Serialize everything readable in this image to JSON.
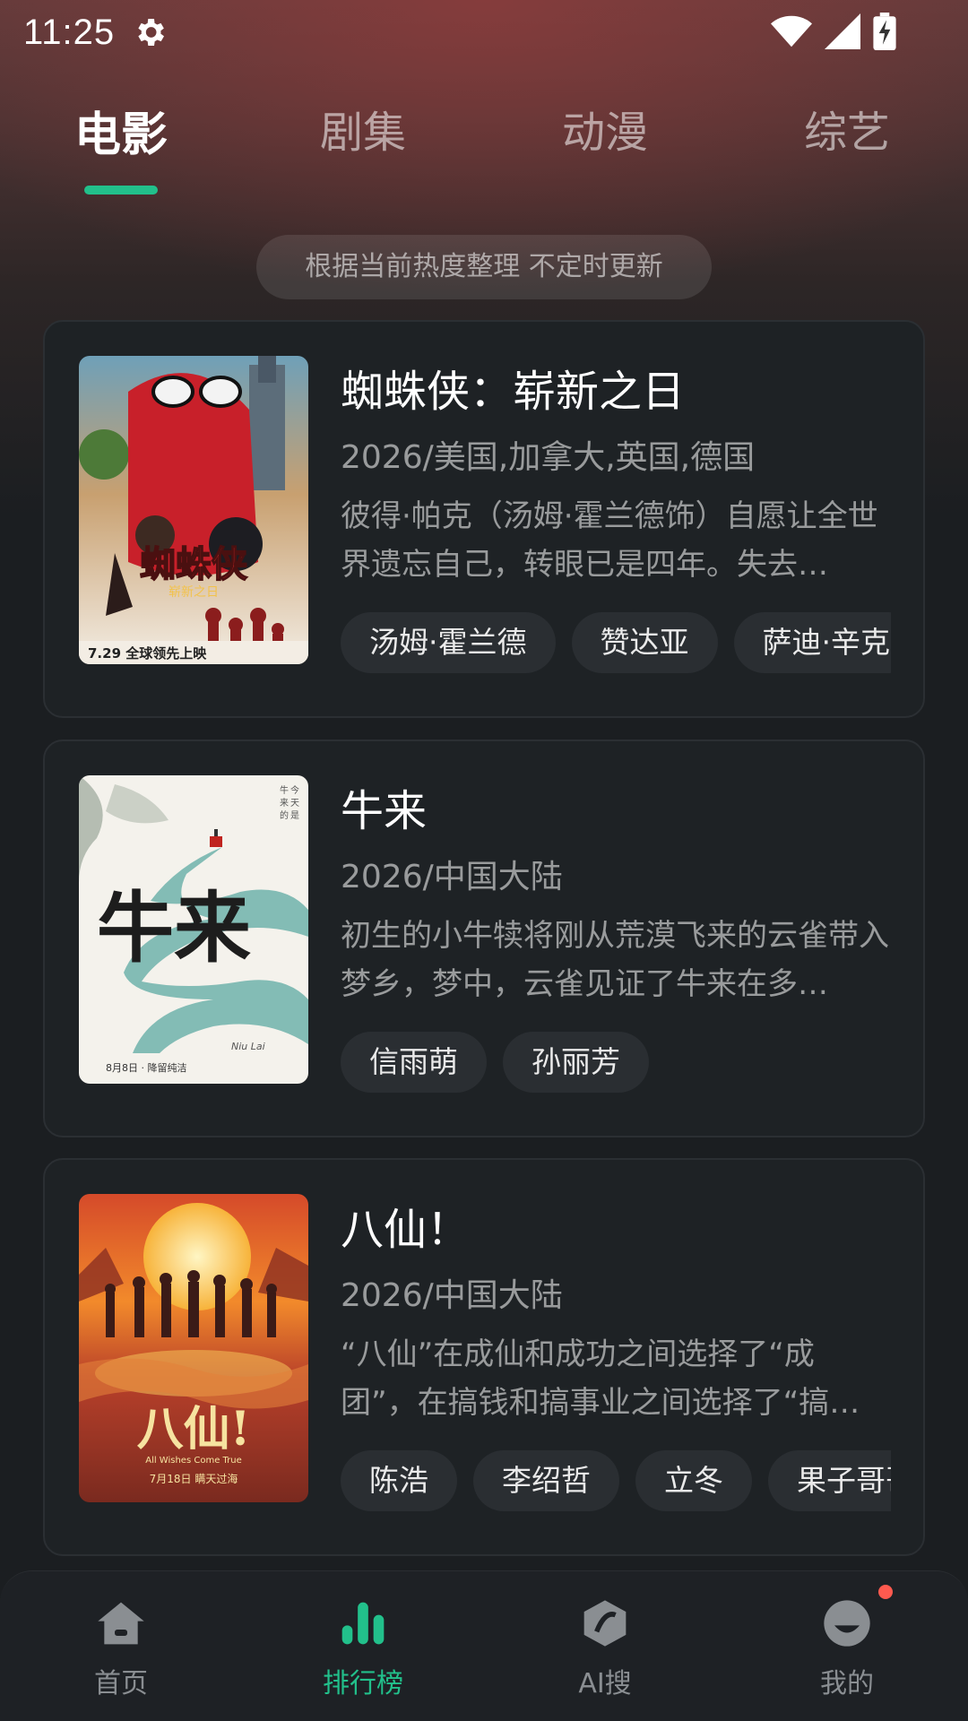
{
  "status_bar": {
    "time": "11:25"
  },
  "top_tabs": [
    "电影",
    "剧集",
    "动漫",
    "综艺"
  ],
  "active_tab": "电影",
  "notice": "根据当前热度整理 不定时更新",
  "movies": [
    {
      "title": "蜘蛛侠：崭新之日",
      "meta": "2026/美国,加拿大,英国,德国",
      "desc": "彼得·帕克（汤姆·霍兰德饰）自愿让全世界遗忘自己，转眼已是四年。失去…",
      "cast": [
        "汤姆·霍兰德",
        "赞达亚",
        "萨迪·辛克"
      ],
      "poster": {
        "top_text": "7.29 全球领先上映",
        "logo_text": "蜘蛛侠",
        "logo_sub": "崭新之日"
      }
    },
    {
      "title": "牛来",
      "meta": "2026/中国大陆",
      "desc": "初生的小牛犊将刚从荒漠飞来的云雀带入梦乡，梦中，云雀见证了牛来在多…",
      "cast": [
        "信雨萌",
        "孙丽芳"
      ],
      "poster": {
        "logo_text": "牛来",
        "sub_text": "Niu Lai",
        "date_text": "8月8日 · 降留纯洁"
      }
    },
    {
      "title": "八仙！",
      "meta": "2026/中国大陆",
      "desc": "“八仙”在成仙和成功之间选择了“成团”，在搞钱和搞事业之间选择了“搞…",
      "cast": [
        "陈浩",
        "李绍哲",
        "立冬",
        "果子哥哥"
      ],
      "poster": {
        "logo_text": "八仙!",
        "sub_text": "All Wishes Come True",
        "date_text": "7月18日 瞒天过海"
      }
    }
  ],
  "bottom_nav": [
    {
      "label": "首页",
      "icon": "home-icon"
    },
    {
      "label": "排行榜",
      "icon": "chart-bars-icon"
    },
    {
      "label": "AI搜",
      "icon": "ai-search-icon"
    },
    {
      "label": "我的",
      "icon": "profile-icon"
    }
  ],
  "active_nav": "排行榜",
  "colors": {
    "accent": "#22c08b",
    "badge": "#ff5a4f",
    "card_bg": "#1e2225",
    "page_bg": "#1b1e21"
  }
}
